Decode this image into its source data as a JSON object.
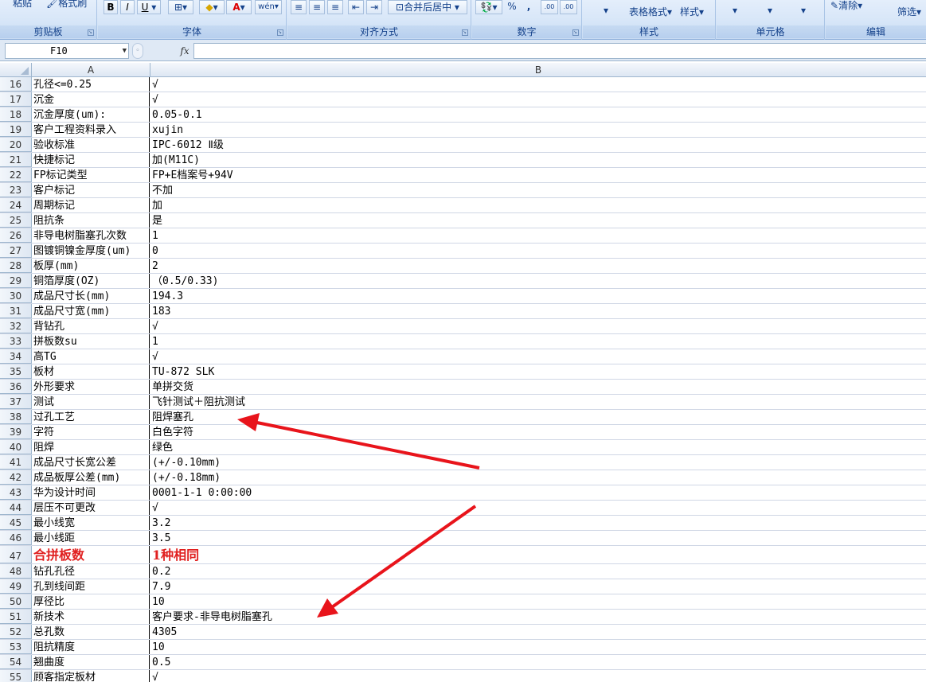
{
  "ribbon": {
    "clipboard": {
      "paste": "粘贴",
      "format_painter": "格式刷",
      "label": "剪贴板"
    },
    "font": {
      "bold": "B",
      "italic": "I",
      "underline": "U",
      "label": "字体"
    },
    "alignment": {
      "merge_center": "合并后居中",
      "label": "对齐方式"
    },
    "number": {
      "percent": "%",
      "comma": ",",
      "inc_decimal": ".00",
      "dec_decimal": ".00",
      "label": "数字"
    },
    "styles": {
      "table_format": "表格格式",
      "cell_style": "样式",
      "label": "样式"
    },
    "cells": {
      "label": "单元格"
    },
    "editing": {
      "clear": "清除",
      "filter": "筛选",
      "label": "编辑"
    }
  },
  "formula_bar": {
    "name_box": "F10",
    "fx": "fx",
    "formula": ""
  },
  "columns": [
    "A",
    "B"
  ],
  "rows": [
    {
      "num": "16",
      "a": "孔径<=0.25",
      "b": "√"
    },
    {
      "num": "17",
      "a": "沉金",
      "b": "√"
    },
    {
      "num": "18",
      "a": "沉金厚度(um):",
      "b": "0.05-0.1"
    },
    {
      "num": "19",
      "a": "客户工程资料录入",
      "b": "xujin"
    },
    {
      "num": "20",
      "a": "验收标准",
      "b": "IPC-6012 Ⅱ级"
    },
    {
      "num": "21",
      "a": "快捷标记",
      "b": "加(M11C)"
    },
    {
      "num": "22",
      "a": "FP标记类型",
      "b": "FP+E档案号+94V"
    },
    {
      "num": "23",
      "a": "客户标记",
      "b": "不加"
    },
    {
      "num": "24",
      "a": "周期标记",
      "b": "加"
    },
    {
      "num": "25",
      "a": "阻抗条",
      "b": "是"
    },
    {
      "num": "26",
      "a": "非导电树脂塞孔次数",
      "b": "1"
    },
    {
      "num": "27",
      "a": "图镀铜镍金厚度(um)",
      "b": "0"
    },
    {
      "num": "28",
      "a": "板厚(mm)",
      "b": "2"
    },
    {
      "num": "29",
      "a": "铜箔厚度(OZ)",
      "b": "（0.5/0.33)"
    },
    {
      "num": "30",
      "a": "成品尺寸长(mm)",
      "b": "194.3"
    },
    {
      "num": "31",
      "a": "成品尺寸宽(mm)",
      "b": "183"
    },
    {
      "num": "32",
      "a": "背钻孔",
      "b": "√"
    },
    {
      "num": "33",
      "a": "拼板数su",
      "b": "1"
    },
    {
      "num": "34",
      "a": "高TG",
      "b": "√"
    },
    {
      "num": "35",
      "a": "板材",
      "b": "TU-872 SLK"
    },
    {
      "num": "36",
      "a": "外形要求",
      "b": "单拼交货"
    },
    {
      "num": "37",
      "a": "测试",
      "b": "飞针测试＋阻抗测试"
    },
    {
      "num": "38",
      "a": "过孔工艺",
      "b": "阻焊塞孔"
    },
    {
      "num": "39",
      "a": "字符",
      "b": "白色字符"
    },
    {
      "num": "40",
      "a": "阻焊",
      "b": "绿色"
    },
    {
      "num": "41",
      "a": "成品尺寸长宽公差",
      "b": "(+/-0.10mm)"
    },
    {
      "num": "42",
      "a": "成品板厚公差(mm)",
      "b": "(+/-0.18mm)"
    },
    {
      "num": "43",
      "a": "华为设计时间",
      "b": "0001-1-1 0:00:00"
    },
    {
      "num": "44",
      "a": "层压不可更改",
      "b": "√"
    },
    {
      "num": "45",
      "a": "最小线宽",
      "b": "3.2"
    },
    {
      "num": "46",
      "a": "最小线距",
      "b": "3.5"
    },
    {
      "num": "47",
      "a": "合拼板数",
      "b": "1种相同",
      "highlight": true
    },
    {
      "num": "48",
      "a": "钻孔孔径",
      "b": "0.2"
    },
    {
      "num": "49",
      "a": "孔到线间距",
      "b": "7.9"
    },
    {
      "num": "50",
      "a": "厚径比",
      "b": "10"
    },
    {
      "num": "51",
      "a": "新技术",
      "b": "客户要求-非导电树脂塞孔"
    },
    {
      "num": "52",
      "a": "总孔数",
      "b": "4305"
    },
    {
      "num": "53",
      "a": "阻抗精度",
      "b": "10"
    },
    {
      "num": "54",
      "a": "翘曲度",
      "b": "0.5"
    },
    {
      "num": "55",
      "a": "顾客指定板材",
      "b": "√"
    }
  ],
  "annotation_color": "#e8141b"
}
